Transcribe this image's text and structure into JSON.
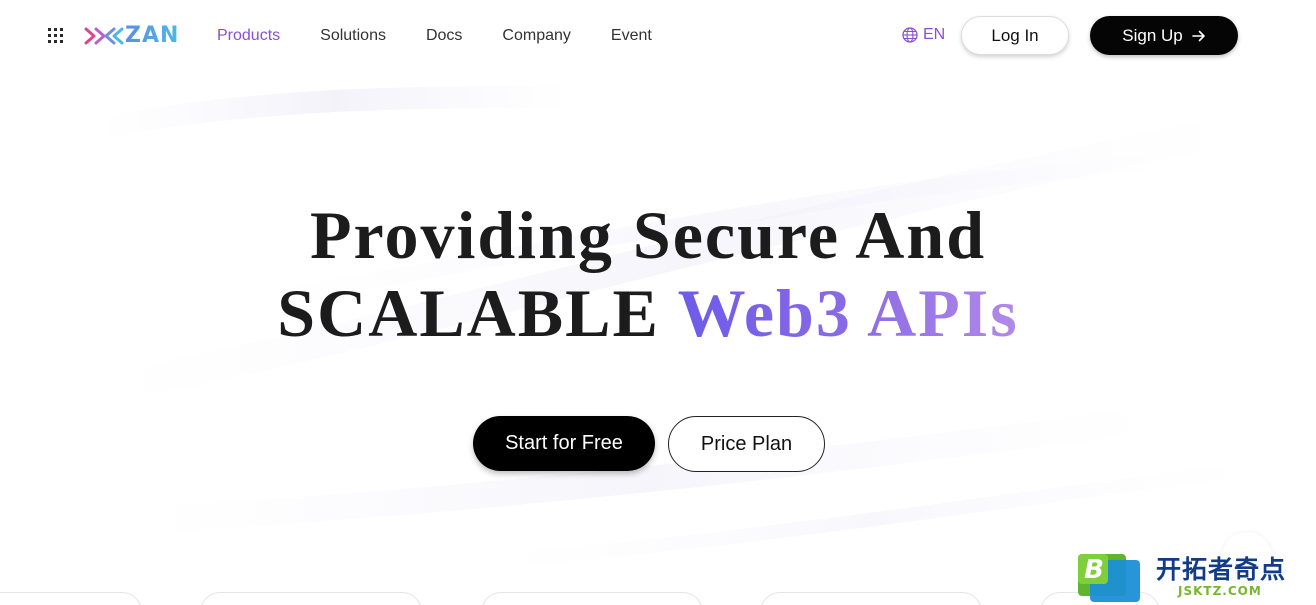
{
  "header": {
    "logo_text": "ZAN",
    "nav": [
      {
        "label": "Products",
        "active": true
      },
      {
        "label": "Solutions",
        "active": false
      },
      {
        "label": "Docs",
        "active": false
      },
      {
        "label": "Company",
        "active": false
      },
      {
        "label": "Event",
        "active": false
      }
    ],
    "language": "EN",
    "login_label": "Log In",
    "signup_label": "Sign Up"
  },
  "hero": {
    "line1": "Providing Secure And",
    "line2_plain": "SCALABLE",
    "line2_accent": "Web3 APIs",
    "primary_cta": "Start for Free",
    "secondary_cta": "Price Plan"
  },
  "watermark": {
    "badge_letter": "B",
    "text_cn": "开拓者奇点",
    "text_en": "JSKTZ.COM"
  },
  "colors": {
    "accent_purple": "#8a4fd6",
    "hero_gradient_start": "#6d5be8",
    "hero_gradient_end": "#b28ae8",
    "logo_pink": "#e0468a",
    "logo_blue": "#4bb9e6"
  }
}
